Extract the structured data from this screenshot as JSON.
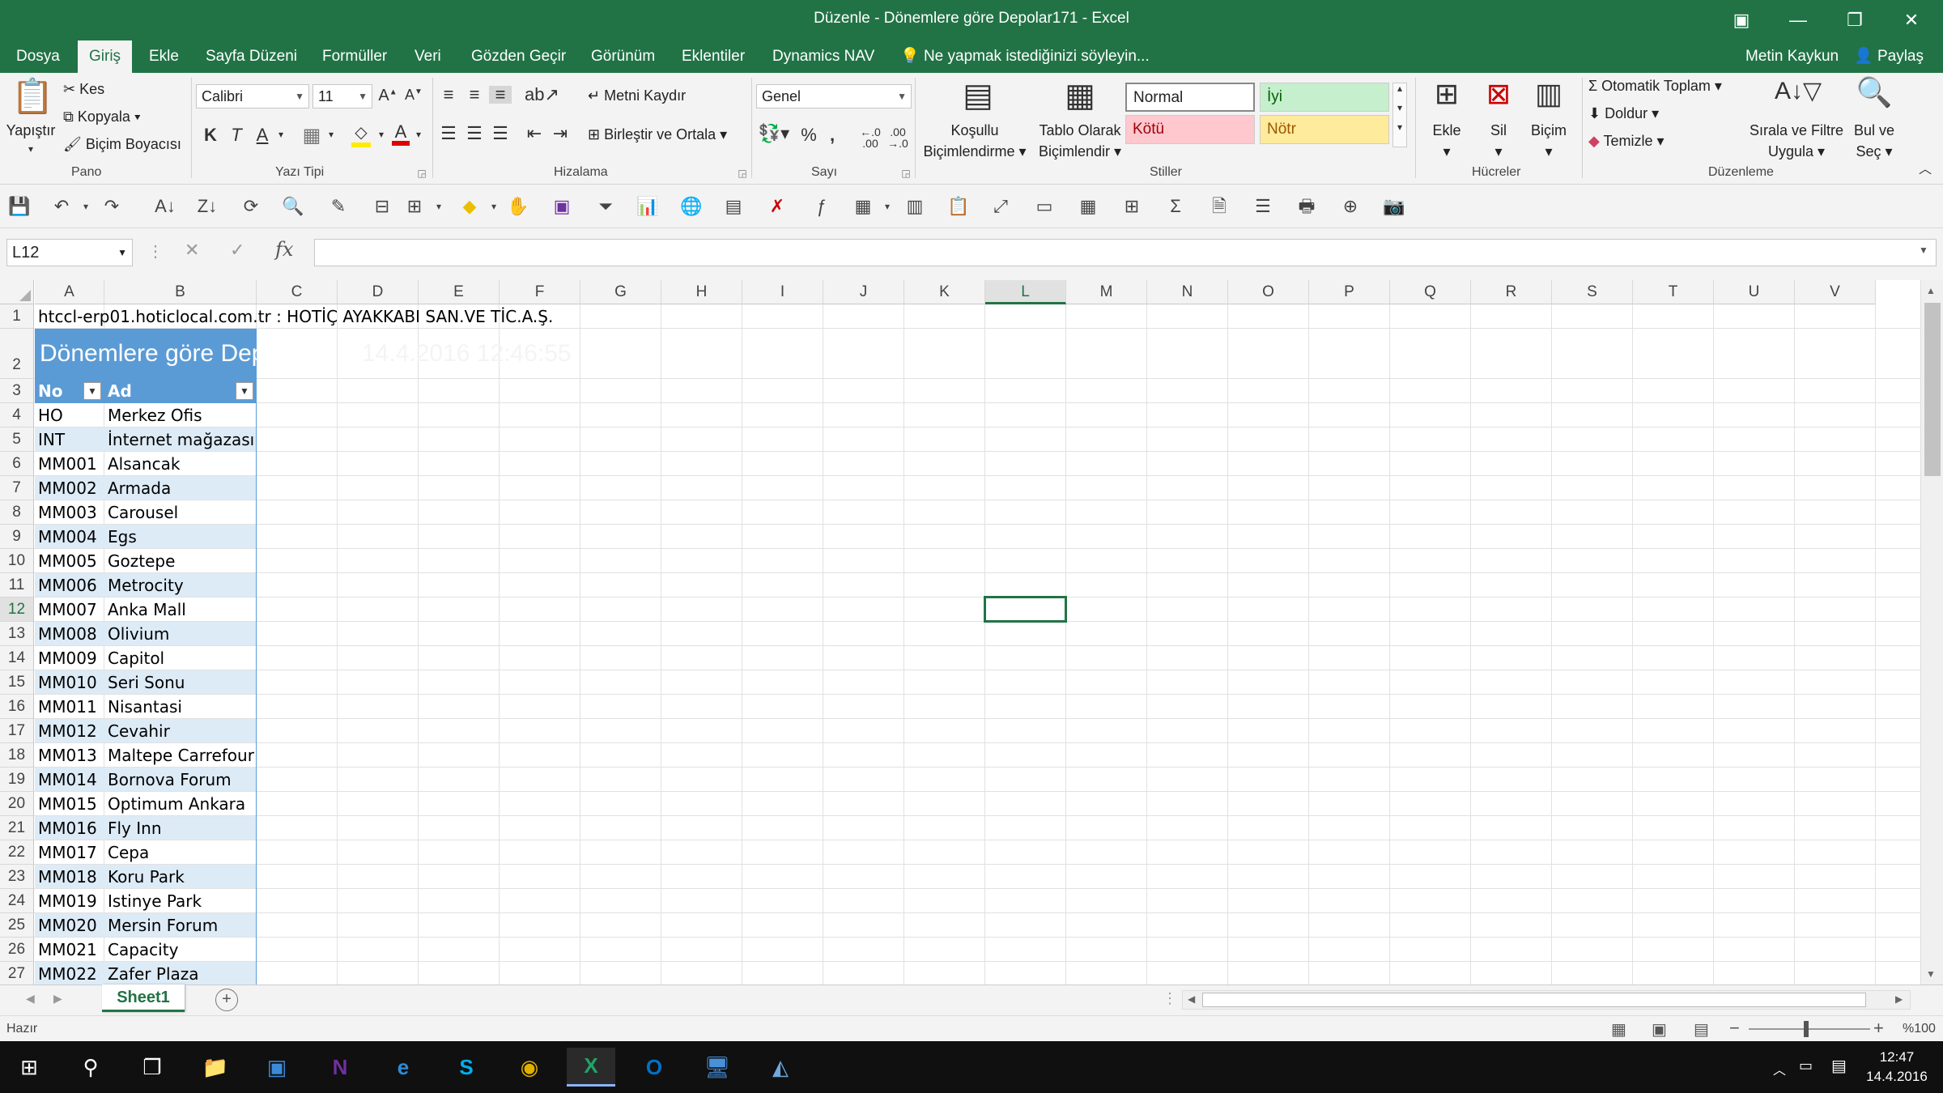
{
  "window": {
    "title": "Düzenle - Dönemlere göre Depolar171 - Excel"
  },
  "menu": {
    "tabs": [
      "Dosya",
      "Giriş",
      "Ekle",
      "Sayfa Düzeni",
      "Formüller",
      "Veri",
      "Gözden Geçir",
      "Görünüm",
      "Eklentiler",
      "Dynamics NAV"
    ],
    "tell_me": "Ne yapmak istediğinizi söyleyin...",
    "user": "Metin Kaykun",
    "share": "Paylaş"
  },
  "ribbon": {
    "clipboard": {
      "paste": "Yapıştır",
      "cut": "Kes",
      "copy": "Kopyala",
      "format_painter": "Biçim Boyacısı",
      "label": "Pano"
    },
    "font": {
      "name": "Calibri",
      "size": "11",
      "bold": "K",
      "italic": "T",
      "underline": "A",
      "label": "Yazı Tipi"
    },
    "alignment": {
      "wrap": "Metni Kaydır",
      "merge": "Birleştir ve Ortala",
      "label": "Hizalama"
    },
    "number": {
      "format": "Genel",
      "percent": "%",
      "comma": ",",
      "label": "Sayı"
    },
    "styles": {
      "conditional": [
        "Koşullu",
        "Biçimlendirme"
      ],
      "format_table": [
        "Tablo Olarak",
        "Biçimlendir"
      ],
      "normal": "Normal",
      "good": "İyi",
      "bad": "Kötü",
      "neutral": "Nötr",
      "label": "Stiller"
    },
    "cells": {
      "insert": "Ekle",
      "delete": "Sil",
      "format": "Biçim",
      "label": "Hücreler"
    },
    "editing": {
      "autosum": "Otomatik Toplam",
      "fill": "Doldur",
      "clear": "Temizle",
      "sort": [
        "Sırala ve Filtre",
        "Uygula"
      ],
      "find": [
        "Bul ve",
        "Seç"
      ],
      "label": "Düzenleme"
    }
  },
  "formula_bar": {
    "name_box": "L12"
  },
  "grid": {
    "columns": [
      "A",
      "B",
      "C",
      "D",
      "E",
      "F",
      "G",
      "H",
      "I",
      "J",
      "K",
      "L",
      "M",
      "N",
      "O",
      "P",
      "Q",
      "R",
      "S",
      "T",
      "U",
      "V"
    ],
    "selected_column": "L",
    "rows": [
      "1",
      "2",
      "3",
      "4",
      "5",
      "6",
      "7",
      "8",
      "9",
      "10",
      "11",
      "12",
      "13",
      "14",
      "15",
      "16",
      "17",
      "18",
      "19",
      "20",
      "21",
      "22",
      "23",
      "24",
      "25",
      "26",
      "27"
    ],
    "selected_row": "12",
    "row1_text": "htccl-erp01.hoticlocal.com.tr : HOTİÇ AYAKKABI SAN.VE TİC.A.Ş.",
    "report_title": "Dönemlere göre Depolar :",
    "report_timestamp": "14.4.2016 12:46:55",
    "header": {
      "no": "No",
      "ad": "Ad"
    },
    "records": [
      {
        "no": "HO",
        "ad": "Merkez Ofis"
      },
      {
        "no": "INT",
        "ad": "İnternet mağazası"
      },
      {
        "no": "MM001",
        "ad": "Alsancak"
      },
      {
        "no": "MM002",
        "ad": "Armada"
      },
      {
        "no": "MM003",
        "ad": "Carousel"
      },
      {
        "no": "MM004",
        "ad": "Egs"
      },
      {
        "no": "MM005",
        "ad": "Goztepe"
      },
      {
        "no": "MM006",
        "ad": "Metrocity"
      },
      {
        "no": "MM007",
        "ad": "Anka Mall"
      },
      {
        "no": "MM008",
        "ad": "Olivium"
      },
      {
        "no": "MM009",
        "ad": "Capitol"
      },
      {
        "no": "MM010",
        "ad": "Seri Sonu"
      },
      {
        "no": "MM011",
        "ad": "Nisantasi"
      },
      {
        "no": "MM012",
        "ad": "Cevahir"
      },
      {
        "no": "MM013",
        "ad": "Maltepe Carrefour"
      },
      {
        "no": "MM014",
        "ad": "Bornova Forum"
      },
      {
        "no": "MM015",
        "ad": "Optimum Ankara"
      },
      {
        "no": "MM016",
        "ad": "Fly Inn"
      },
      {
        "no": "MM017",
        "ad": "Cepa"
      },
      {
        "no": "MM018",
        "ad": "Koru Park"
      },
      {
        "no": "MM019",
        "ad": "Istinye Park"
      },
      {
        "no": "MM020",
        "ad": "Mersin Forum"
      },
      {
        "no": "MM021",
        "ad": "Capacity"
      },
      {
        "no": "MM022",
        "ad": "Zafer Plaza"
      }
    ]
  },
  "sheet_tabs": {
    "active": "Sheet1",
    "add": "+"
  },
  "status": {
    "ready": "Hazır",
    "zoom": "%100"
  },
  "taskbar": {
    "time": "12:47",
    "date": "14.4.2016"
  },
  "colors": {
    "accent": "#217346",
    "table_header": "#5b9bd5",
    "band": "#ddebf7"
  }
}
